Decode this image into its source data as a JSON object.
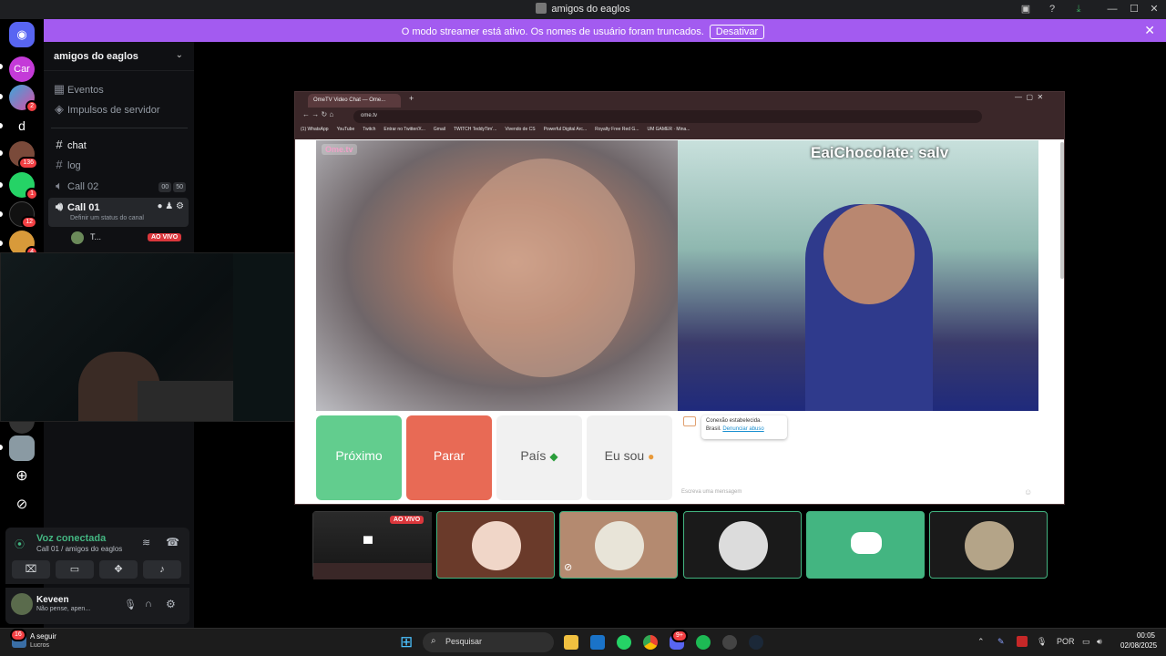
{
  "window": {
    "title": "amigos do eaglos"
  },
  "banner": {
    "message": "O modo streamer está ativo. Os nomes de usuário foram truncados.",
    "button": "Desativar"
  },
  "servers": [
    {
      "name": "Car",
      "badge": ""
    },
    {
      "name": "",
      "badge": "2"
    },
    {
      "name": "d",
      "badge": ""
    },
    {
      "name": "",
      "badge": "136"
    },
    {
      "name": "",
      "badge": "1"
    },
    {
      "name": "",
      "badge": "12"
    },
    {
      "name": "",
      "badge": "4"
    }
  ],
  "sidebar": {
    "server_name": "amigos do eaglos",
    "items": [
      {
        "label": "Eventos"
      },
      {
        "label": "Impulsos de servidor"
      }
    ],
    "channels": [
      {
        "label": "chat"
      },
      {
        "label": "log"
      },
      {
        "label": "Call 02",
        "count_a": "00",
        "count_b": "50"
      },
      {
        "label": "Call 01",
        "status_hint": "Definir um status do canal"
      }
    ],
    "voice_user": {
      "name": "T...",
      "live": "AO VIVO"
    }
  },
  "voice_panel": {
    "status": "Voz conectada",
    "location": "Call 01 / amigos do eaglos"
  },
  "user_panel": {
    "name": "Keveen",
    "status": "Não pense, apen..."
  },
  "browser": {
    "tab_title": "OmeTV Video Chat — Ome...",
    "url": "ome.tv",
    "bookmarks": [
      "(1) WhatsApp",
      "YouTube",
      "Twitch",
      "Entrar no Twitter/X...",
      "Gmail",
      "TWITCH TeddyTim'...",
      "Vivendo de CS",
      "Powerful Digital Arc...",
      "Royalty Free Red G...",
      "UM GAMER · Mina..."
    ],
    "logo": "Ome.tv",
    "overlay_text": "EaiChocolate: salv",
    "buttons": {
      "next": "Próximo",
      "stop": "Parar",
      "country": "País",
      "i_am": "Eu sou"
    },
    "chat_message_1": "Conexão estabelecida.",
    "chat_message_2": "Brasil.",
    "chat_link": "Denunciar abuso",
    "chat_placeholder": "Escreva uma mensagem"
  },
  "stream_tiles": {
    "live": "AO VIVO"
  },
  "taskbar": {
    "weather_title": "A seguir",
    "weather_sub": "Lucros",
    "weather_badge": "16",
    "search": "Pesquisar",
    "lang": "POR",
    "time": "00:05",
    "date": "02/08/2025",
    "discord_badge": "9+"
  },
  "colors": {
    "discord_green": "#43b581",
    "stop_red": "#e86a55",
    "next_green": "#62cd8e",
    "banner": "#a35bf0"
  }
}
